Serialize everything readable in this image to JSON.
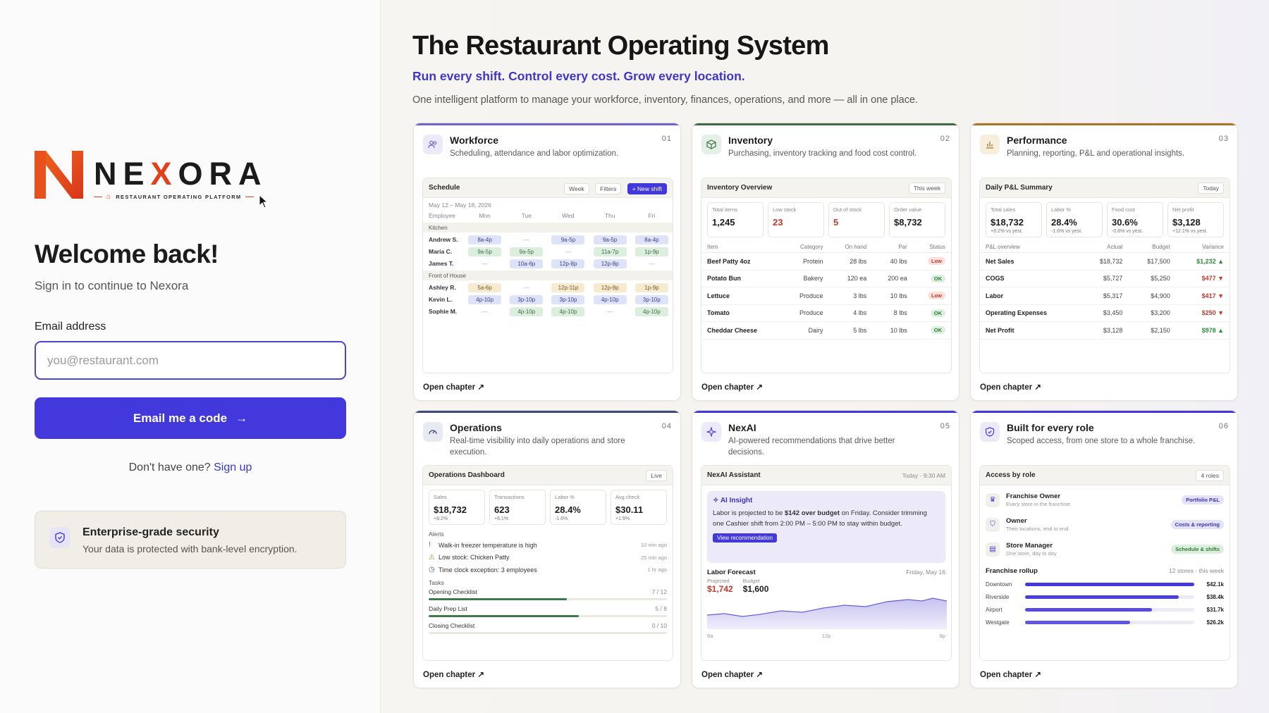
{
  "brand": {
    "name": "NEXORA",
    "tagline": "RESTAURANT OPERATING PLATFORM",
    "accent": "#e0401a"
  },
  "login": {
    "heading": "Welcome back!",
    "subheading": "Sign in to continue to Nexora",
    "email_label": "Email address",
    "email_placeholder": "you@restaurant.com",
    "email_value": "",
    "submit_label": "Email me a code",
    "signup_prompt": "Don't have one?",
    "signup_link": "Sign up",
    "security_title": "Enterprise-grade security",
    "security_desc": "Your data is protected with bank-level encryption.",
    "primary_color": "#4338dc"
  },
  "hero": {
    "title": "The Restaurant Operating System",
    "subtitle": "Run every shift. Control every cost. Grow every location.",
    "description": "One intelligent platform to manage your workforce, inventory, finances, operations, and more — all in one place."
  },
  "cards": {
    "open_label": "Open chapter",
    "workforce": {
      "title": "Workforce",
      "num": "01",
      "desc": "Scheduling, attendance and labor optimization.",
      "accent": "#6f63c7",
      "panel_title": "Schedule",
      "btn_week": "Week",
      "btn_filters": "Filters",
      "btn_new": "+ New shift",
      "range": "May 12 – May 18, 2026",
      "columns": [
        "Employee",
        "Mon",
        "Tue",
        "Wed",
        "Thu",
        "Fri"
      ],
      "groups": [
        {
          "label": "Kitchen",
          "rows": [
            {
              "name": "Andrew S.",
              "cells": [
                "8a-4p",
                "—",
                "9a-5p",
                "9a-5p",
                "8a-4p"
              ],
              "color": "blue"
            },
            {
              "name": "Maria C.",
              "cells": [
                "9a-5p",
                "9a-5p",
                "—",
                "11a-7p",
                "1p-9p"
              ],
              "color": "green"
            },
            {
              "name": "James T.",
              "cells": [
                "—",
                "10a-6p",
                "12p-8p",
                "12p-8p",
                "—"
              ],
              "color": "blue"
            }
          ]
        },
        {
          "label": "Front of House",
          "rows": [
            {
              "name": "Ashley R.",
              "cells": [
                "5a-6p",
                "—",
                "12p-11p",
                "12p-8p",
                "1p-9p"
              ],
              "color": "amber"
            },
            {
              "name": "Kevin L.",
              "cells": [
                "4p-10p",
                "3p-10p",
                "3p-10p",
                "4p-10p",
                "3p-10p"
              ],
              "color": "blue"
            },
            {
              "name": "Sophie M.",
              "cells": [
                "—",
                "4p-10p",
                "4p-10p",
                "—",
                "4p-10p"
              ],
              "color": "green"
            }
          ]
        }
      ]
    },
    "inventory": {
      "title": "Inventory",
      "num": "02",
      "desc": "Purchasing, inventory tracking and food cost control.",
      "accent": "#3b6e46",
      "panel_title": "Inventory Overview",
      "period": "This week",
      "stats": [
        {
          "label": "Total items",
          "value": "1,245",
          "tone": ""
        },
        {
          "label": "Low stock",
          "value": "23",
          "tone": "red"
        },
        {
          "label": "Out of stock",
          "value": "5",
          "tone": "red"
        },
        {
          "label": "Order value",
          "value": "$8,732",
          "tone": ""
        }
      ],
      "columns": [
        "Item",
        "Category",
        "On hand",
        "Par",
        "Status"
      ],
      "rows": [
        [
          "Beef Patty 4oz",
          "Protein",
          "28 lbs",
          "40 lbs",
          "Low"
        ],
        [
          "Potato Bun",
          "Bakery",
          "120 ea",
          "200 ea",
          "OK"
        ],
        [
          "Lettuce",
          "Produce",
          "3 lbs",
          "10 lbs",
          "Low"
        ],
        [
          "Tomato",
          "Produce",
          "4 lbs",
          "8 lbs",
          "OK"
        ],
        [
          "Cheddar Cheese",
          "Dairy",
          "5 lbs",
          "10 lbs",
          "OK"
        ]
      ]
    },
    "performance": {
      "title": "Performance",
      "num": "03",
      "desc": "Planning, reporting, P&L and operational insights.",
      "accent": "#a8742a",
      "panel_title": "Daily P&L Summary",
      "period": "Today",
      "stats": [
        {
          "label": "Total sales",
          "value": "$18,732",
          "delta": "+8.2% vs yest."
        },
        {
          "label": "Labor %",
          "value": "28.4%",
          "delta": "-1.6% vs yest."
        },
        {
          "label": "Food cost",
          "value": "30.6%",
          "delta": "-0.8% vs yest."
        },
        {
          "label": "Net profit",
          "value": "$3,128",
          "delta": "+12.1% vs yest."
        }
      ],
      "columns": [
        "P&L overview",
        "Actual",
        "Budget",
        "Variance"
      ],
      "rows": [
        {
          "name": "Net Sales",
          "actual": "$18,732",
          "budget": "$17,500",
          "variance": "$1,232 ▲",
          "tone": "gr"
        },
        {
          "name": "COGS",
          "actual": "$5,727",
          "budget": "$5,250",
          "variance": "$477 ▼",
          "tone": "red"
        },
        {
          "name": "Labor",
          "actual": "$5,317",
          "budget": "$4,900",
          "variance": "$417 ▼",
          "tone": "red"
        },
        {
          "name": "Operating Expenses",
          "actual": "$3,450",
          "budget": "$3,200",
          "variance": "$250 ▼",
          "tone": "red"
        },
        {
          "name": "Net Profit",
          "actual": "$3,128",
          "budget": "$2,150",
          "variance": "$978 ▲",
          "tone": "gr"
        }
      ]
    },
    "operations": {
      "title": "Operations",
      "num": "04",
      "desc": "Real-time visibility into daily operations and store execution.",
      "accent": "#3f4a7a",
      "panel_title": "Operations Dashboard",
      "period": "Live",
      "stats": [
        {
          "label": "Sales",
          "value": "$18,732",
          "delta": "+8.2%"
        },
        {
          "label": "Transactions",
          "value": "623",
          "delta": "+6.1%"
        },
        {
          "label": "Labor %",
          "value": "28.4%",
          "delta": "-1.6%"
        },
        {
          "label": "Avg check",
          "value": "$30.11",
          "delta": "+1.9%"
        }
      ],
      "alerts_label": "Alerts",
      "alerts": [
        {
          "icon": "!",
          "text": "Walk-in freezer temperature is high",
          "time": "10 min ago",
          "color": "#c0392b"
        },
        {
          "icon": "⚠",
          "text": "Low stock: Chicken Patty",
          "time": "25 min ago",
          "color": "#b8761f"
        },
        {
          "icon": "◷",
          "text": "Time clock exception: 3 employees",
          "time": "1 hr ago",
          "color": "#3b5ea8"
        }
      ],
      "tasks_label": "Tasks",
      "tasks": [
        {
          "name": "Opening Checklist",
          "count": "7 / 12",
          "progress": 0.58
        },
        {
          "name": "Daily Prep List",
          "count": "5 / 8",
          "progress": 0.63
        },
        {
          "name": "Closing Checklist",
          "count": "0 / 10",
          "progress": 0
        }
      ]
    },
    "nexai": {
      "title": "NexAI",
      "num": "05",
      "desc": "AI-powered recommendations that drive better decisions.",
      "accent": "#4338dc",
      "panel_title": "NexAI Assistant",
      "time": "Today · 9:30 AM",
      "insight_title": "AI Insight",
      "insight_pre": "Labor is projected to be ",
      "insight_bold": "$142 over budget",
      "insight_post": " on Friday. Consider trimming one Cashier shift from 2:00 PM – 5:00 PM to stay within budget.",
      "insight_btn": "View recommendation",
      "forecast_title": "Labor Forecast",
      "forecast_date": "Friday, May 16",
      "projected_label": "Projected",
      "projected_value": "$1,742",
      "budget_label": "Budget",
      "budget_value": "$1,600",
      "x_labels": [
        "6a",
        "12p",
        "6p"
      ]
    },
    "roles": {
      "title": "Built for every role",
      "num": "06",
      "desc": "Scoped access, from one store to a whole franchise.",
      "accent": "#4338dc",
      "panel_title": "Access by role",
      "count": "4 roles",
      "roles": [
        {
          "name": "Franchise Owner",
          "desc": "Every store in the franchise",
          "tag": "Portfolio P&L",
          "tag_bg": "#e4e2f7",
          "tag_fg": "#3a35b8",
          "icon": "♛"
        },
        {
          "name": "Owner",
          "desc": "Their locations, end to end",
          "tag": "Costs & reporting",
          "tag_bg": "#e4e2f7",
          "tag_fg": "#3a35b8",
          "icon": "⛉"
        },
        {
          "name": "Store Manager",
          "desc": "One store, day to day",
          "tag": "Schedule & shifts",
          "tag_bg": "#dceedd",
          "tag_fg": "#2e7b36",
          "icon": "▤"
        }
      ],
      "rollup_title": "Franchise rollup",
      "rollup_meta": "12 stores · this week",
      "rollup": [
        {
          "name": "Downtown",
          "value": "$42.1k",
          "share": 1.0
        },
        {
          "name": "Riverside",
          "value": "$38.4k",
          "share": 0.91
        },
        {
          "name": "Airport",
          "value": "$31.7k",
          "share": 0.75
        },
        {
          "name": "Westgate",
          "value": "$26.2k",
          "share": 0.62
        }
      ]
    }
  }
}
